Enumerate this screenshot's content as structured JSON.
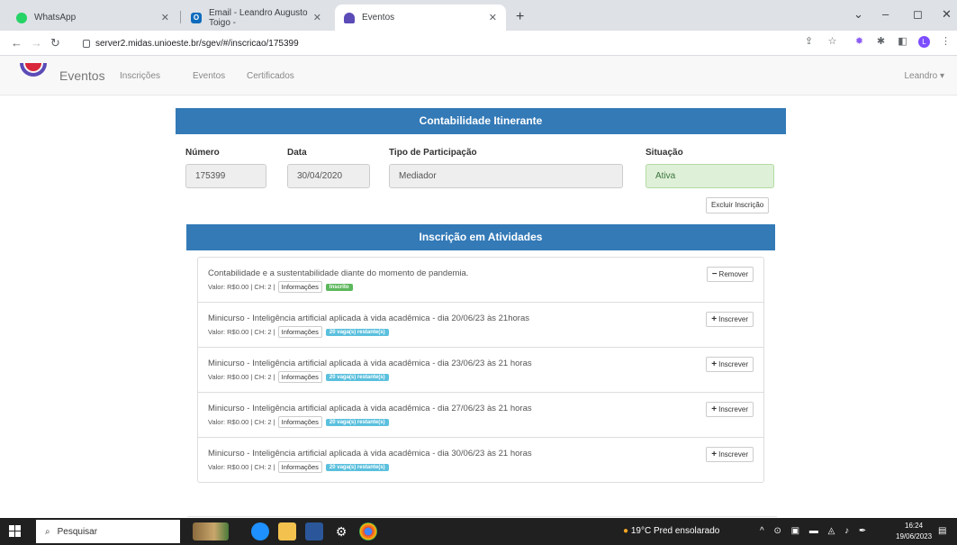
{
  "browser": {
    "tabs": [
      {
        "label": "WhatsApp",
        "icon": "whatsapp-icon"
      },
      {
        "label": "Email - Leandro Augusto Toigo - ",
        "icon": "outlook-icon"
      },
      {
        "label": "Eventos",
        "icon": "eventos-logo-icon"
      }
    ],
    "url": "server2.midas.unioeste.br/sgev/#/inscricao/175399"
  },
  "nav": {
    "brand": "Eventos",
    "links": [
      "Inscrições",
      "Eventos",
      "Certificados"
    ],
    "user": "Leandro"
  },
  "event": {
    "title": "Contabilidade Itinerante",
    "fields": {
      "numero_label": "Número",
      "numero": "175399",
      "data_label": "Data",
      "data": "30/04/2020",
      "tipo_label": "Tipo de Participação",
      "tipo": "Mediador",
      "situacao_label": "Situação",
      "situacao": "Ativa"
    },
    "excluir": "Excluir Inscrição"
  },
  "activities": {
    "title": "Inscrição em Atividades",
    "items": [
      {
        "title": "Contabilidade e a sustentabilidade diante do momento de pandemia.",
        "meta": "Valor: R$0.00 | CH: 2 |",
        "info": "Informações",
        "badge": "Inscrito",
        "action": "Remover",
        "action_symbol": "−"
      },
      {
        "title": "Minicurso - Inteligência artificial aplicada à vida acadêmica - dia 20/06/23 às 21horas",
        "meta": "Valor: R$0.00 | CH: 2 |",
        "info": "Informações",
        "badge": "20 vaga(s) restante(s)",
        "action": "Inscrever",
        "action_symbol": "+"
      },
      {
        "title": "Minicurso - Inteligência artificial aplicada à vida acadêmica - dia 23/06/23 às 21 horas",
        "meta": "Valor: R$0.00 | CH: 2 |",
        "info": "Informações",
        "badge": "20 vaga(s) restante(s)",
        "action": "Inscrever",
        "action_symbol": "+"
      },
      {
        "title": "Minicurso - Inteligência artificial aplicada à vida acadêmica - dia 27/06/23 às 21 horas",
        "meta": "Valor: R$0.00 | CH: 2 |",
        "info": "Informações",
        "badge": "20 vaga(s) restante(s)",
        "action": "Inscrever",
        "action_symbol": "+"
      },
      {
        "title": "Minicurso - Inteligência artificial aplicada à vida acadêmica - dia 30/06/23 às 21 horas",
        "meta": "Valor: R$0.00 | CH: 2 |",
        "info": "Informações",
        "badge": "20 vaga(s) restante(s)",
        "action": "Inscrever",
        "action_symbol": "+"
      }
    ]
  },
  "taskbar": {
    "search": "Pesquisar",
    "weather": "19°C  Pred ensolarado",
    "time": "16:24",
    "date": "19/06/2023"
  },
  "colors": {
    "primary": "#337ab7",
    "success": "#5cb85c",
    "info": "#5bc0de"
  }
}
